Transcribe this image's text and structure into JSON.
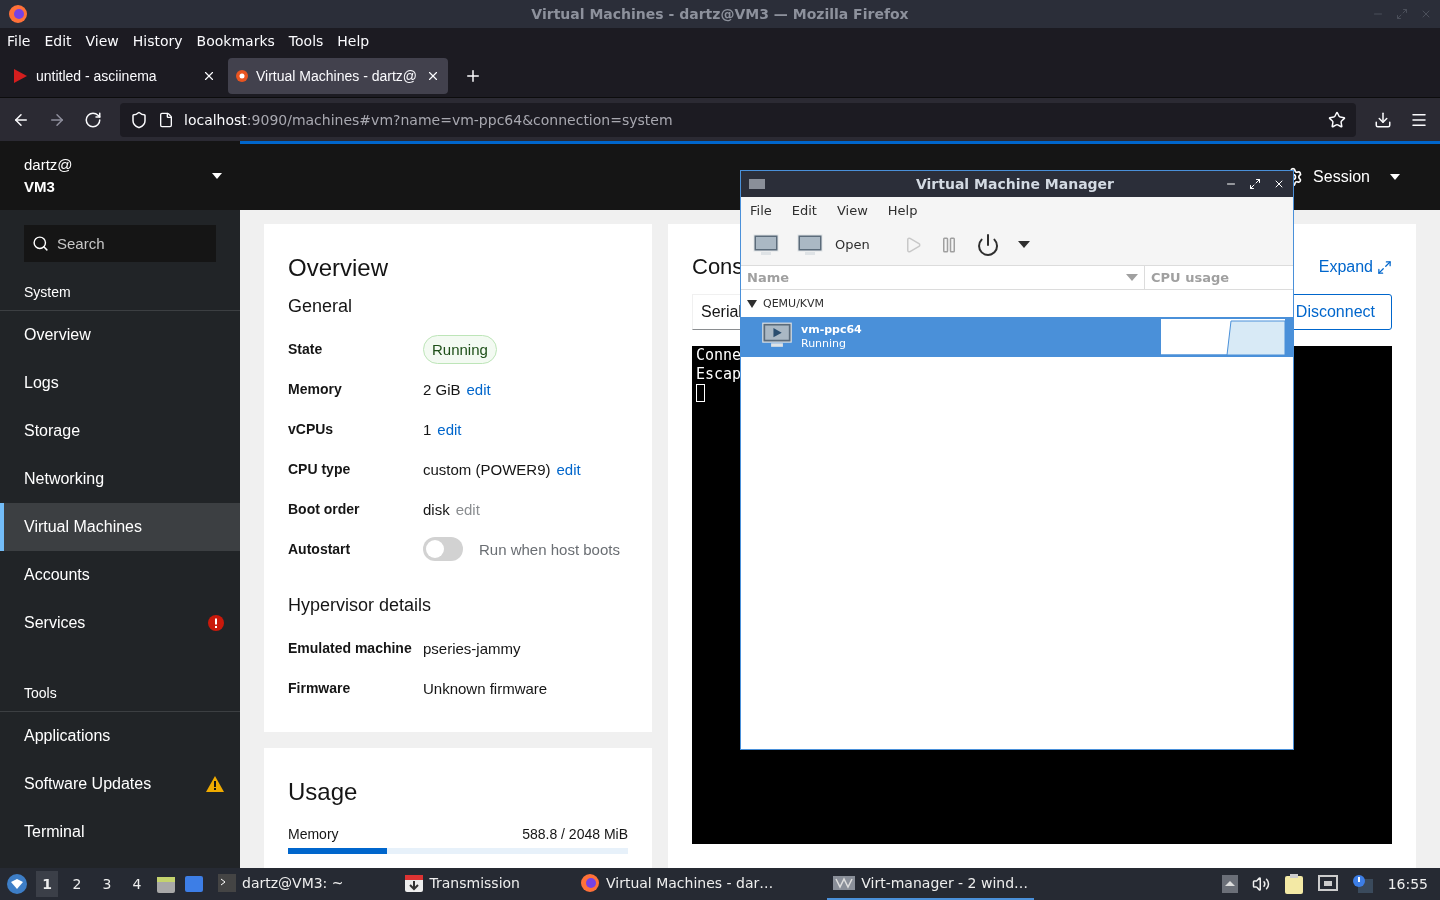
{
  "window": {
    "title": "Virtual Machines - dartz@VM3 — Mozilla Firefox"
  },
  "menu": [
    "File",
    "Edit",
    "View",
    "History",
    "Bookmarks",
    "Tools",
    "Help"
  ],
  "tabs": [
    {
      "label": "untitled - asciinema",
      "selected": false
    },
    {
      "label": "Virtual Machines - dartz@",
      "selected": true
    }
  ],
  "address": {
    "host": "localhost",
    "path": ":9090/machines#vm?name=vm-ppc64&connection=system"
  },
  "cockpit": {
    "user": "dartz@",
    "host": "VM3",
    "search": {
      "placeholder": "Search"
    },
    "session": "Session",
    "sections": [
      {
        "label": "System",
        "items": [
          {
            "label": "Overview",
            "selected": false,
            "kind": "plain"
          },
          {
            "label": "Logs",
            "selected": false,
            "kind": "plain"
          },
          {
            "label": "Storage",
            "selected": false,
            "kind": "plain"
          },
          {
            "label": "Networking",
            "selected": false,
            "kind": "plain"
          },
          {
            "label": "Virtual Machines",
            "selected": true,
            "kind": "plain"
          },
          {
            "label": "Accounts",
            "selected": false,
            "kind": "plain"
          },
          {
            "label": "Services",
            "selected": false,
            "kind": "error"
          }
        ]
      },
      {
        "label": "Tools",
        "items": [
          {
            "label": "Applications",
            "selected": false,
            "kind": "plain"
          },
          {
            "label": "Software Updates",
            "selected": false,
            "kind": "warning"
          },
          {
            "label": "Terminal",
            "selected": false,
            "kind": "plain"
          }
        ]
      }
    ]
  },
  "overview": {
    "title": "Overview",
    "general": "General",
    "rows": [
      {
        "label": "State",
        "kind": "badge",
        "value": "Running"
      },
      {
        "label": "Memory",
        "kind": "text",
        "value": "2 GiB",
        "action": "edit",
        "disabled": false
      },
      {
        "label": "vCPUs",
        "kind": "text",
        "value": "1",
        "action": "edit",
        "disabled": false
      },
      {
        "label": "CPU type",
        "kind": "text",
        "value": "custom (POWER9)",
        "action": "edit",
        "disabled": false
      },
      {
        "label": "Boot order",
        "kind": "text",
        "value": "disk",
        "action": "edit",
        "disabled": true
      },
      {
        "label": "Autostart",
        "kind": "switch",
        "value": "Run when host boots",
        "on": false
      }
    ],
    "hypervisor": "Hypervisor details",
    "hyper_rows": [
      {
        "label": "Emulated machine",
        "value": "pseries-jammy"
      },
      {
        "label": "Firmware",
        "value": "Unknown firmware"
      }
    ]
  },
  "usage": {
    "title": "Usage",
    "label": "Memory",
    "reading": "588.8 / 2048 MiB",
    "level": 0.29
  },
  "console": {
    "title": "Cons",
    "type": "Serial",
    "expand": "Expand",
    "disconnect": "Disconnect",
    "lines": [
      "Conne",
      "Escap"
    ]
  },
  "vmm": {
    "title": "Virtual Machine Manager",
    "menu": [
      "File",
      "Edit",
      "View",
      "Help"
    ],
    "open": "Open",
    "columns": [
      "Name",
      "CPU usage"
    ],
    "groups": [
      {
        "label": "QEMU/KVM",
        "expanded": true,
        "vms": [
          {
            "name": "vm-ppc64",
            "status": "Running",
            "selected": true
          }
        ]
      }
    ]
  },
  "taskbar": {
    "workspaces": [
      {
        "label": "1",
        "selected": true
      },
      {
        "label": "2",
        "selected": false
      },
      {
        "label": "3",
        "selected": false
      },
      {
        "label": "4",
        "selected": false
      }
    ],
    "tasks": [
      {
        "label": "dartz@VM3: ~",
        "selected": false
      },
      {
        "label": "Transmission",
        "selected": false
      },
      {
        "label": "Virtual Machines - dar…",
        "selected": false
      },
      {
        "label": "Virt-manager - 2 wind…",
        "selected": true
      }
    ],
    "clock": "16:55"
  }
}
